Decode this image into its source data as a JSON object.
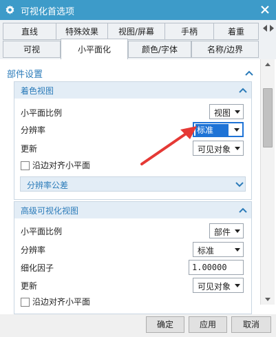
{
  "window": {
    "title": "可视化首选项",
    "icon": "gear-icon",
    "close_icon": "close-icon"
  },
  "tabs": {
    "row1": [
      "直线",
      "特殊效果",
      "视图/屏幕",
      "手柄",
      "着重"
    ],
    "row2": [
      "可视",
      "小平面化",
      "颜色/字体",
      "名称/边界"
    ],
    "active": "小平面化"
  },
  "section": {
    "title": "部件设置"
  },
  "group1": {
    "title": "着色视图",
    "rows": [
      {
        "label": "小平面比例",
        "value": "视图"
      },
      {
        "label": "分辨率",
        "value": "标准"
      },
      {
        "label": "更新",
        "value": "可见对象"
      }
    ],
    "checkbox_label": "沿边对齐小平面",
    "tolerance_label": "分辨率公差"
  },
  "group2": {
    "title": "高级可视化视图",
    "rows": [
      {
        "label": "小平面比例",
        "value": "部件"
      },
      {
        "label": "分辨率",
        "value": "标准"
      },
      {
        "label": "细化因子",
        "value": "1.00000"
      },
      {
        "label": "更新",
        "value": "可见对象"
      }
    ],
    "checkbox_label": "沿边对齐小平面"
  },
  "footer": {
    "ok_label": "确定",
    "apply_label": "应用",
    "cancel_label": "取消"
  },
  "colors": {
    "titlebar": "#3d9bc9",
    "accent": "#2b7bb9",
    "highlight": "#1e73d6",
    "arrow": "#e53935"
  }
}
